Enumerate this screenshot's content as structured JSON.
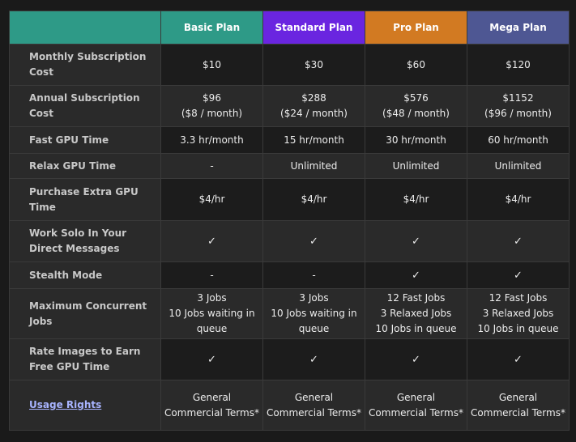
{
  "header": {
    "corner_label": "",
    "plans": [
      {
        "name": "Basic Plan",
        "color": "#2e9a87"
      },
      {
        "name": "Standard Plan",
        "color": "#6a25e0"
      },
      {
        "name": "Pro Plan",
        "color": "#d27a22"
      },
      {
        "name": "Mega Plan",
        "color": "#4e5793"
      }
    ],
    "corner_color": "#2e9a87"
  },
  "rows": [
    {
      "feature": "Monthly Subscription Cost",
      "values": [
        "$10",
        "$30",
        "$60",
        "$120"
      ]
    },
    {
      "feature": "Annual Subscription Cost",
      "values": [
        [
          "$96",
          "($8 / month)"
        ],
        [
          "$288",
          "($24 / month)"
        ],
        [
          "$576",
          "($48 / month)"
        ],
        [
          "$1152",
          "($96 / month)"
        ]
      ]
    },
    {
      "feature": "Fast GPU Time",
      "values": [
        "3.3 hr/month",
        "15 hr/month",
        "30 hr/month",
        "60 hr/month"
      ]
    },
    {
      "feature": "Relax GPU Time",
      "values": [
        "-",
        "Unlimited",
        "Unlimited",
        "Unlimited"
      ]
    },
    {
      "feature": "Purchase Extra GPU Time",
      "values": [
        "$4/hr",
        "$4/hr",
        "$4/hr",
        "$4/hr"
      ]
    },
    {
      "feature": "Work Solo In Your Direct Messages",
      "values": [
        "✓",
        "✓",
        "✓",
        "✓"
      ]
    },
    {
      "feature": "Stealth Mode",
      "values": [
        "-",
        "-",
        "✓",
        "✓"
      ]
    },
    {
      "feature": "Maximum Concurrent Jobs",
      "values": [
        [
          "3 Jobs",
          "10 Jobs waiting in queue"
        ],
        [
          "3 Jobs",
          "10 Jobs waiting in queue"
        ],
        [
          "12 Fast Jobs",
          "3 Relaxed Jobs",
          "10 Jobs in queue"
        ],
        [
          "12 Fast Jobs",
          "3 Relaxed Jobs",
          "10 Jobs in queue"
        ]
      ]
    },
    {
      "feature": "Rate Images to Earn Free GPU Time",
      "values": [
        "✓",
        "✓",
        "✓",
        "✓"
      ]
    },
    {
      "feature": "Usage Rights",
      "feature_is_link": true,
      "values": [
        "General Commercial Terms*",
        "General Commercial Terms*",
        "General Commercial Terms*",
        "General Commercial Terms*"
      ]
    }
  ]
}
